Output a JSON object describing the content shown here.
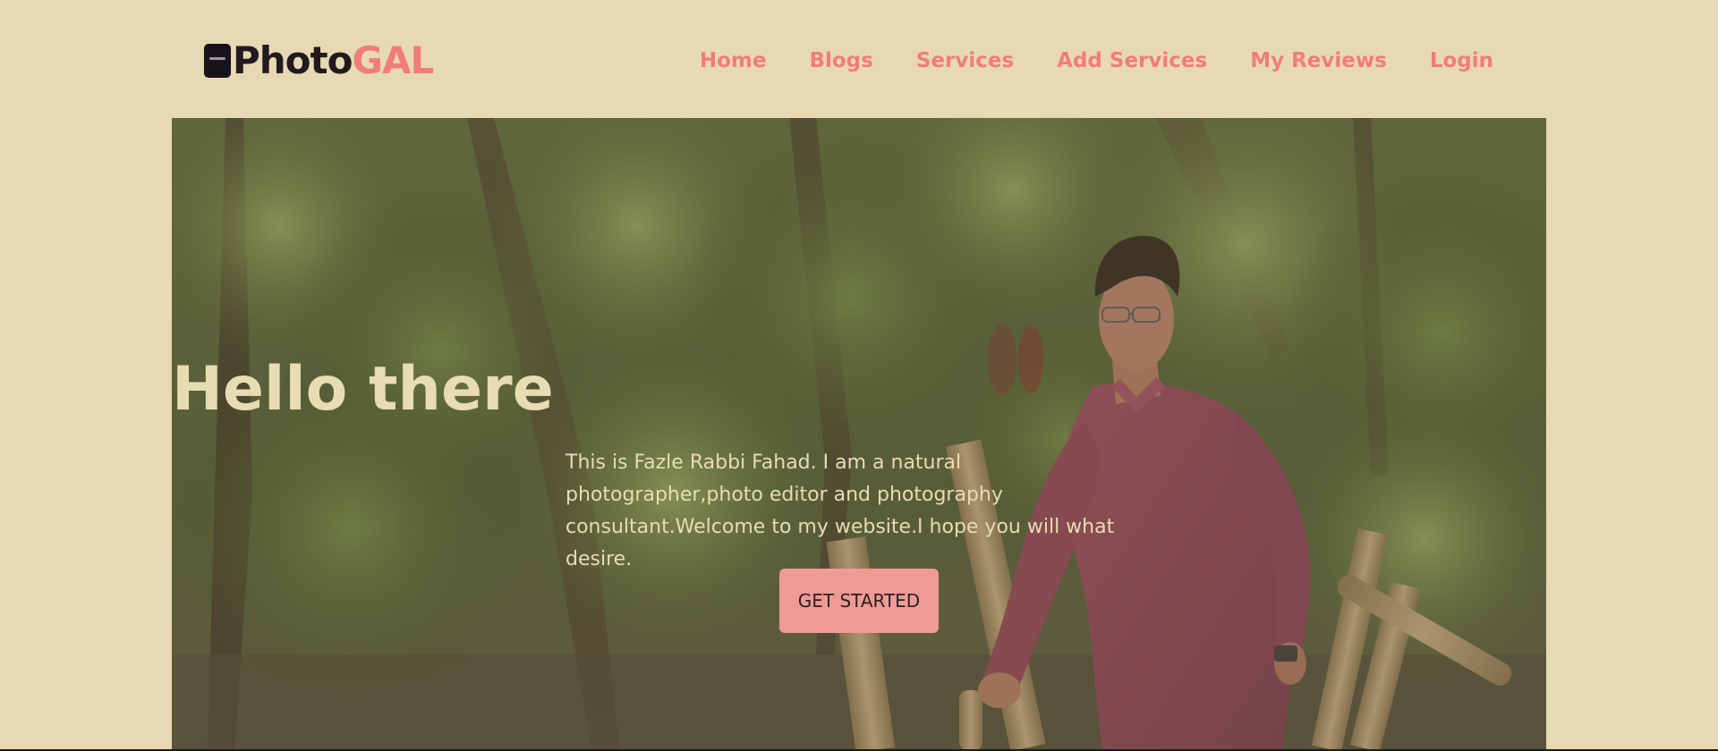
{
  "brand": {
    "logo_icon": "camera-icon",
    "name_part1": "Photo",
    "name_part2": "GAL",
    "colors": {
      "dark": "#221a1e",
      "accent": "#f27c7a"
    }
  },
  "nav": {
    "items": [
      {
        "label": "Home"
      },
      {
        "label": "Blogs"
      },
      {
        "label": "Services"
      },
      {
        "label": "Add Services"
      },
      {
        "label": "My Reviews"
      },
      {
        "label": "Login"
      }
    ]
  },
  "hero": {
    "title": "Hello there",
    "description": "This is Fazle Rabbi Fahad. I am a natural photographer,photo editor and photography consultant.Welcome to my website.I hope you will what desire.",
    "cta_label": "GET STARTED",
    "colors": {
      "text": "#e8dcb3",
      "button": "#f09a95"
    }
  },
  "page": {
    "background": "#e6d9b3"
  }
}
